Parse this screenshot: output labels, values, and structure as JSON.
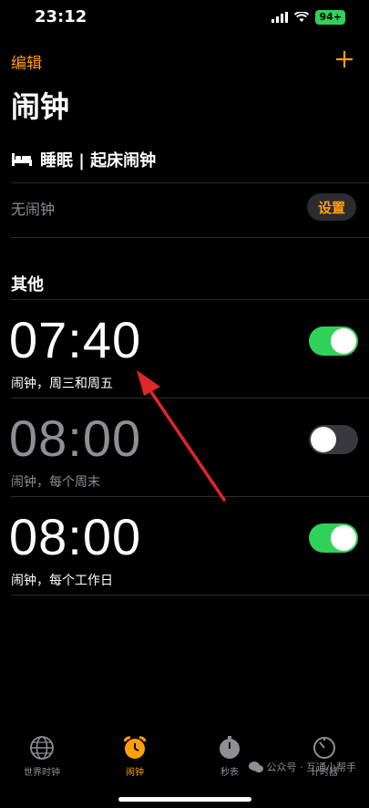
{
  "status_bar": {
    "time": "23:12",
    "battery": "94+"
  },
  "nav": {
    "edit": "编辑",
    "add": "+"
  },
  "title": "闹钟",
  "sleep": {
    "title": "睡眠 | 起床闹钟",
    "no_alarm": "无闹钟",
    "setup": "设置"
  },
  "other": {
    "title": "其他"
  },
  "alarms": [
    {
      "time": "07:40",
      "label": "闹钟，周三和周五",
      "enabled": true
    },
    {
      "time": "08:00",
      "label": "闹钟，每个周末",
      "enabled": false
    },
    {
      "time": "08:00",
      "label": "闹钟，每个工作日",
      "enabled": true
    }
  ],
  "tabs": [
    {
      "label": "世界时钟",
      "icon": "globe-icon"
    },
    {
      "label": "闹钟",
      "icon": "alarm-clock-icon",
      "active": true
    },
    {
      "label": "秒表",
      "icon": "stopwatch-icon"
    },
    {
      "label": "计时器",
      "icon": "timer-icon"
    }
  ],
  "watermark": "公众号 · 互通小帮手",
  "colors": {
    "accent": "#ff9f0a",
    "toggle_on": "#30d158",
    "annotation_arrow": "#e0262b"
  }
}
